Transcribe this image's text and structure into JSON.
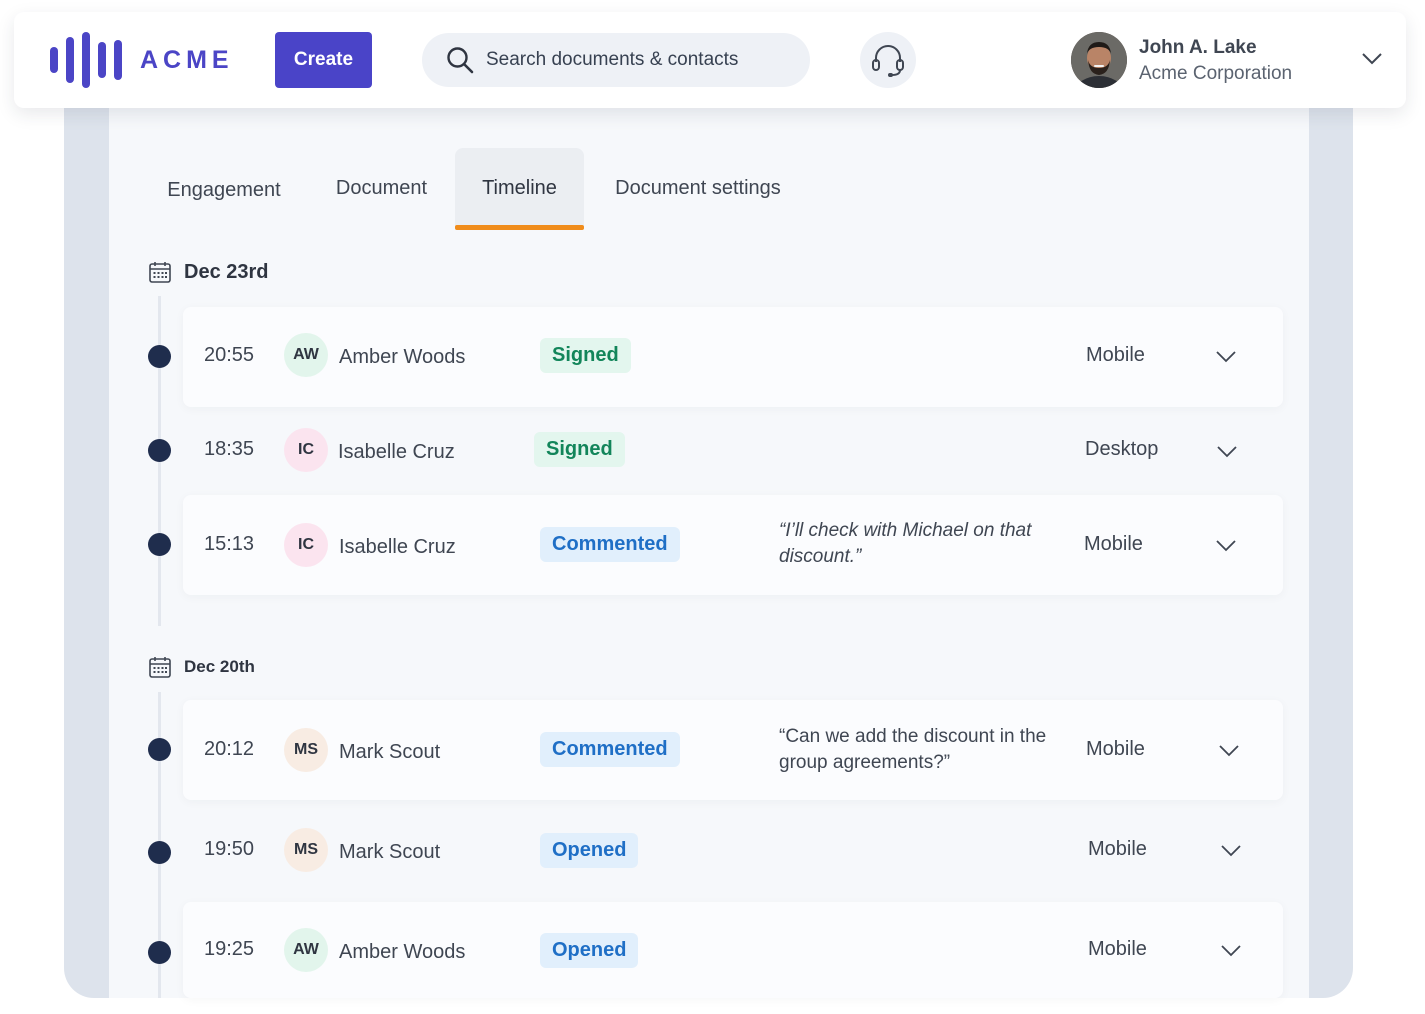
{
  "brand": {
    "name": "ACME",
    "color": "#4b45c6"
  },
  "header": {
    "create_label": "Create",
    "search_placeholder": "Search documents & contacts",
    "support_icon": "headset-icon",
    "user": {
      "name": "John A. Lake",
      "company": "Acme Corporation"
    }
  },
  "tabs": [
    {
      "label": "Engagement",
      "active": false
    },
    {
      "label": "Document",
      "active": false
    },
    {
      "label": "Timeline",
      "active": true
    },
    {
      "label": "Document settings",
      "active": false
    }
  ],
  "groups": [
    {
      "date": "Dec 23rd",
      "events": [
        {
          "time": "20:55",
          "initials": "AW",
          "name": "Amber Woods",
          "status": "Signed",
          "comment": "",
          "device": "Mobile"
        },
        {
          "time": "18:35",
          "initials": "IC",
          "name": "Isabelle Cruz",
          "status": "Signed",
          "comment": "",
          "device": "Desktop"
        },
        {
          "time": "15:13",
          "initials": "IC",
          "name": "Isabelle Cruz",
          "status": "Commented",
          "comment": "“I’ll check with Michael on that discount.”",
          "device": "Mobile"
        }
      ]
    },
    {
      "date": "Dec 20th",
      "events": [
        {
          "time": "20:12",
          "initials": "MS",
          "name": "Mark Scout",
          "status": "Commented",
          "comment": "“Can we add the discount in the group agreements?”",
          "device": "Mobile"
        },
        {
          "time": "19:50",
          "initials": "MS",
          "name": "Mark Scout",
          "status": "Opened",
          "comment": "",
          "device": "Mobile"
        },
        {
          "time": "19:25",
          "initials": "AW",
          "name": "Amber Woods",
          "status": "Opened",
          "comment": "",
          "device": "Mobile"
        }
      ]
    }
  ],
  "colors": {
    "accent": "#4a44c8",
    "active_tab_underline": "#f08c1b",
    "signed": "#12855a",
    "commented": "#1f6fc6",
    "opened": "#1f6fc6",
    "timeline_dot": "#1f2d4d",
    "avatar_aw": "#e2f5ec",
    "avatar_ic": "#fbe4ef",
    "avatar_ms": "#f8ece3"
  }
}
